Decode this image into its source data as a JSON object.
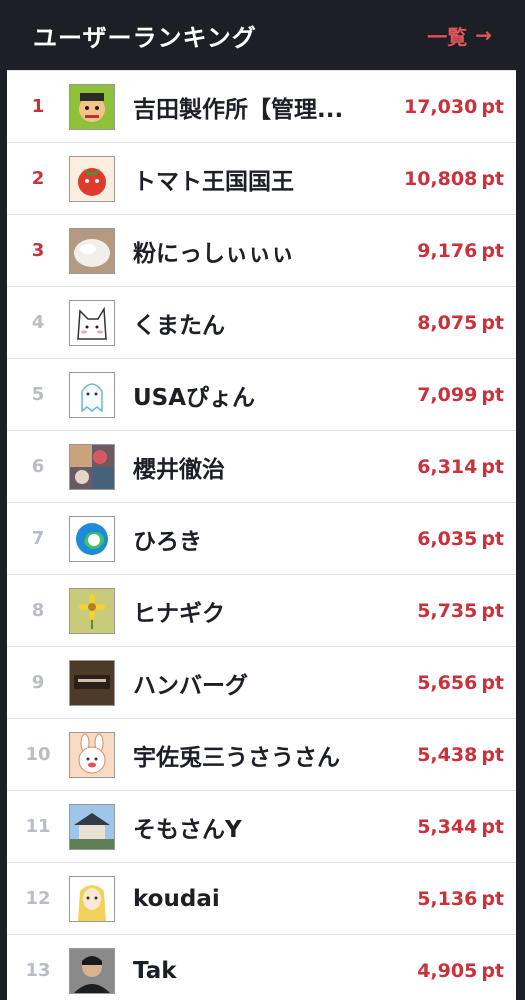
{
  "header": {
    "title": "ユーザーランキング",
    "link_label": "一覧",
    "link_arrow": "→"
  },
  "accent_color": "#c9313b",
  "ranking": [
    {
      "rank": "1",
      "name": "吉田製作所【管理...",
      "points": "17,030",
      "unit": "pt",
      "avatar": "cartoon-face-avatar"
    },
    {
      "rank": "2",
      "name": "トマト王国国王",
      "points": "10,808",
      "unit": "pt",
      "avatar": "tomato-avatar"
    },
    {
      "rank": "3",
      "name": "粉にっしぃぃぃ",
      "points": "9,176",
      "unit": "pt",
      "avatar": "flour-avatar"
    },
    {
      "rank": "4",
      "name": "くまたん",
      "points": "8,075",
      "unit": "pt",
      "avatar": "cat-sketch-avatar"
    },
    {
      "rank": "5",
      "name": "USAぴょん",
      "points": "7,099",
      "unit": "pt",
      "avatar": "ghost-avatar"
    },
    {
      "rank": "6",
      "name": "櫻井徹治",
      "points": "6,314",
      "unit": "pt",
      "avatar": "collage-avatar"
    },
    {
      "rank": "7",
      "name": "ひろき",
      "points": "6,035",
      "unit": "pt",
      "avatar": "edge-logo-avatar"
    },
    {
      "rank": "8",
      "name": "ヒナギク",
      "points": "5,735",
      "unit": "pt",
      "avatar": "daisy-avatar"
    },
    {
      "rank": "9",
      "name": "ハンバーグ",
      "points": "5,656",
      "unit": "pt",
      "avatar": "hamburg-avatar"
    },
    {
      "rank": "10",
      "name": "宇佐兎三うさうさん",
      "points": "5,438",
      "unit": "pt",
      "avatar": "rabbit-avatar"
    },
    {
      "rank": "11",
      "name": "そもさんY",
      "points": "5,344",
      "unit": "pt",
      "avatar": "temple-avatar"
    },
    {
      "rank": "12",
      "name": "koudai",
      "points": "5,136",
      "unit": "pt",
      "avatar": "anime-girl-avatar"
    },
    {
      "rank": "13",
      "name": "Tak",
      "points": "4,905",
      "unit": "pt",
      "avatar": "person-avatar"
    }
  ]
}
